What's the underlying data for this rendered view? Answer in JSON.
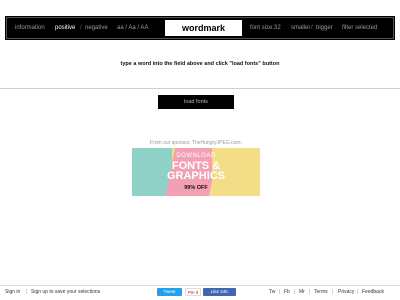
{
  "toolbar": {
    "information": "information",
    "positive": "positive",
    "separator": "/",
    "negative": "negative",
    "case_options": "aa / Aa / AA",
    "wordmark": "wordmark",
    "font_size": "font size:32",
    "smaller": "smaller",
    "bigger": "bigger",
    "filter": "filter selected"
  },
  "instruction": "type a word into the field above and click \"load fonts\" button",
  "load_button": "load fonts",
  "sponsor_note": "From our sponsor, TheHungryJPEG.com:",
  "ad": {
    "line1": "DOWNLOAD",
    "line2": "FONTS &",
    "line3": "GRAPHICS",
    "line4": "99% OFF"
  },
  "footer": {
    "sign_in": "Sign in",
    "signup": "Sign up to save your selections",
    "tweet": "Tweet",
    "pin": "Pin it",
    "fb_like": "Like 24K",
    "tw": "Tw",
    "fb": "Fb",
    "mr": "Mr",
    "terms": "Terms",
    "privacy": "Privacy",
    "feedback": "Feedback"
  },
  "colors": {
    "toolbar_bg": "#000000",
    "ad_teal": "#8fd1c6",
    "ad_pink": "#f4a0b4",
    "ad_yellow": "#f3dd87",
    "tweet_blue": "#1da1f2",
    "facebook_blue": "#4267b2"
  }
}
